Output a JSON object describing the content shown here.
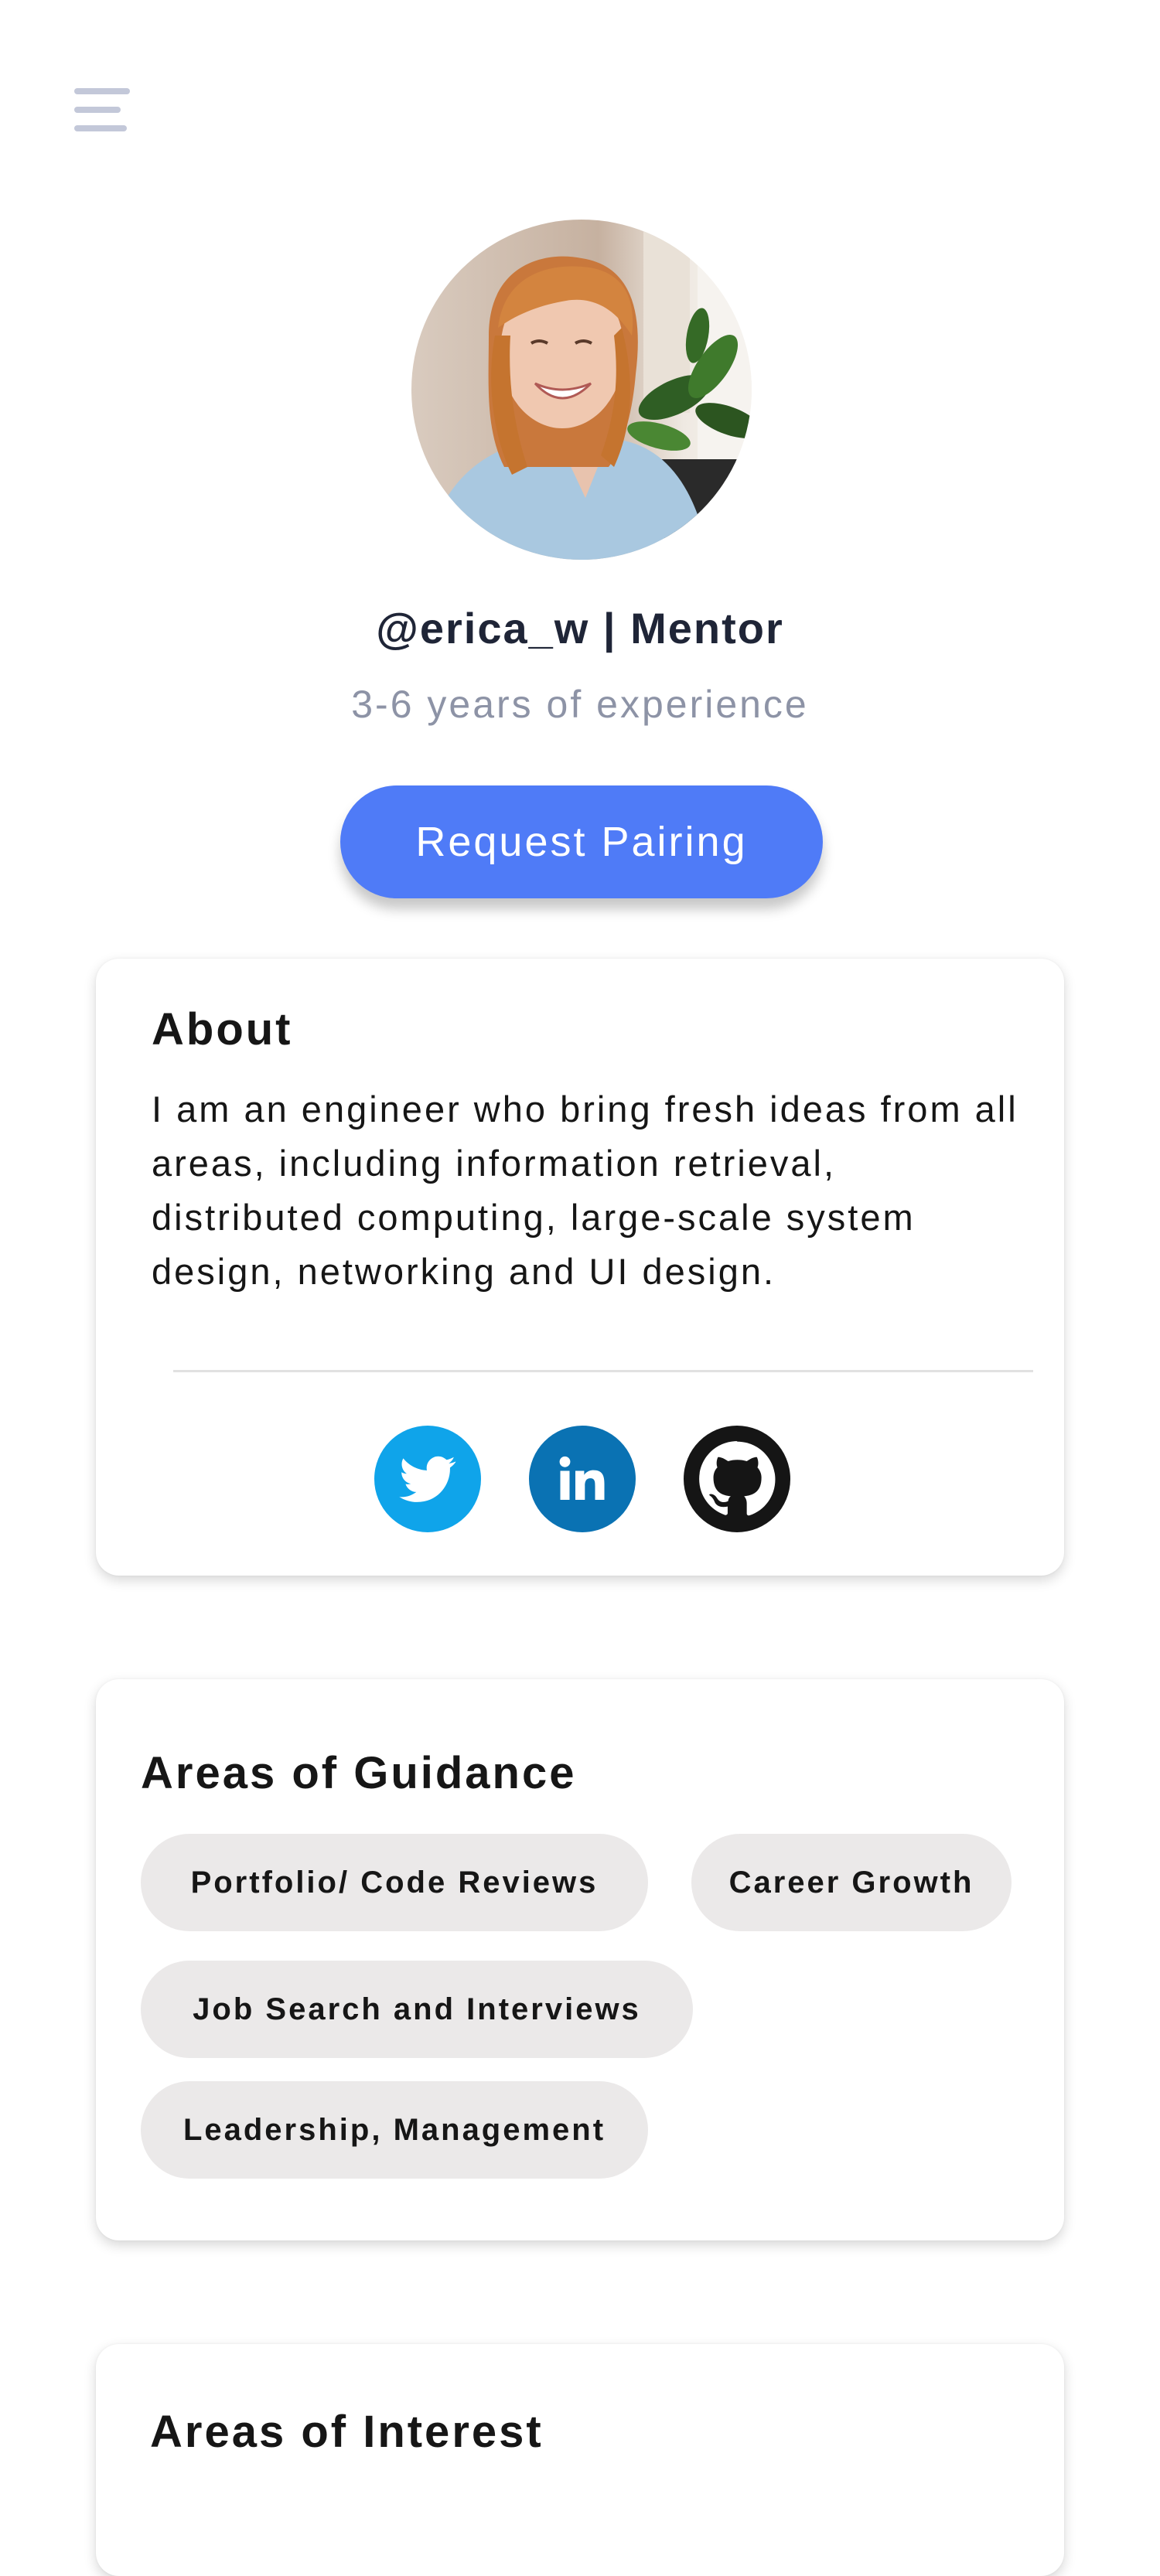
{
  "menu": {
    "icon": "hamburger-menu-icon"
  },
  "profile": {
    "username_line": "@erica_w | Mentor",
    "experience": "3-6 years of experience",
    "request_button_label": "Request Pairing"
  },
  "about": {
    "title": "About",
    "text": "I am an engineer who bring fresh ideas from all areas, including information retrieval, distributed computing, large-scale system design, networking and UI design."
  },
  "social": [
    {
      "name": "twitter-icon",
      "color": "#0fa4ea"
    },
    {
      "name": "linkedin-icon",
      "color": "#0a72b3"
    },
    {
      "name": "github-icon",
      "color": "#151515"
    }
  ],
  "guidance": {
    "title": "Areas of Guidance",
    "chips": [
      "Portfolio/ Code Reviews",
      "Career Growth",
      "Job Search and Interviews",
      "Leadership, Management"
    ]
  },
  "interest": {
    "title": "Areas of Interest"
  },
  "colors": {
    "accent": "#4f7bf7",
    "chip_background": "#ebe9e9",
    "muted_text": "#8d93a6",
    "heading_text": "#1f2537"
  }
}
